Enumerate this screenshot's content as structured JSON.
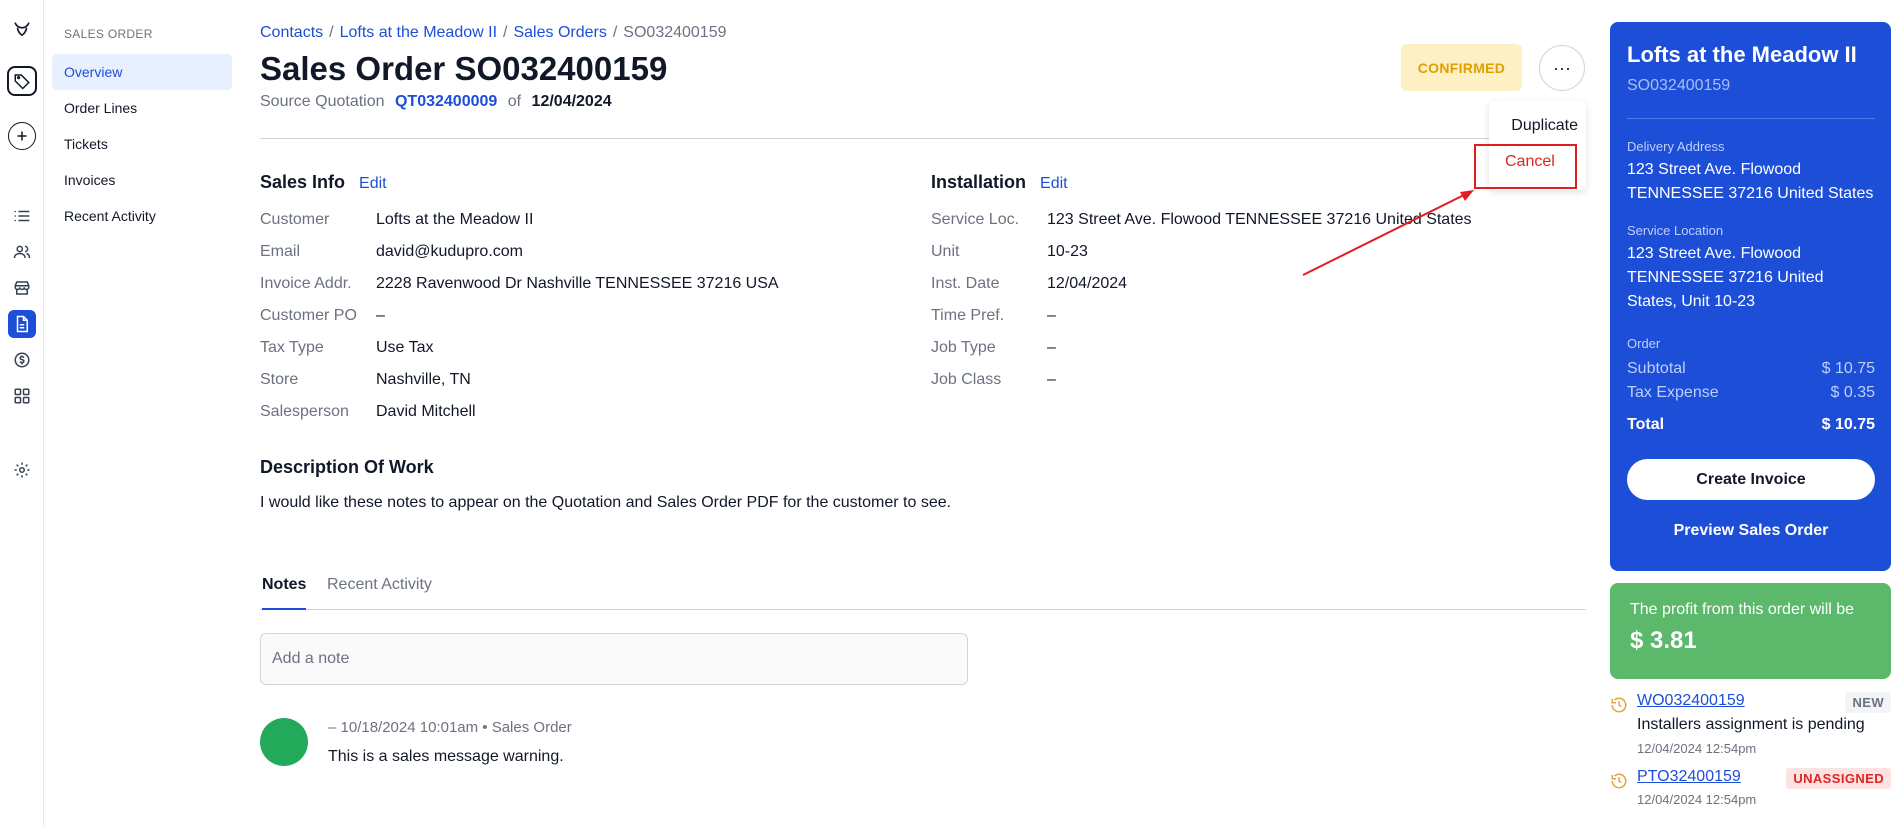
{
  "rail": {
    "icons": [
      "logo-icon",
      "tag-icon",
      "plus-icon",
      "list-icon",
      "users-icon",
      "store-icon",
      "document-icon",
      "money-icon",
      "grid-icon",
      "gear-icon"
    ]
  },
  "subnav": {
    "header": "SALES ORDER",
    "items": [
      {
        "label": "Overview"
      },
      {
        "label": "Order Lines"
      },
      {
        "label": "Tickets"
      },
      {
        "label": "Invoices"
      },
      {
        "label": "Recent Activity"
      }
    ]
  },
  "breadcrumb": {
    "items": [
      "Contacts",
      "Lofts at the Meadow II",
      "Sales Orders"
    ],
    "current": "SO032400159",
    "separator": "/"
  },
  "header": {
    "title": "Sales Order SO032400159",
    "source_label": "Source Quotation",
    "source_quote": "QT032400009",
    "of_label": "of",
    "source_date": "12/04/2024",
    "status": "CONFIRMED",
    "more": "···"
  },
  "menu": {
    "duplicate": "Duplicate",
    "cancel": "Cancel"
  },
  "sales_info": {
    "heading": "Sales Info",
    "edit": "Edit",
    "fields": [
      {
        "label": "Customer",
        "value": "Lofts at the Meadow II"
      },
      {
        "label": "Email",
        "value": "david@kudupro.com"
      },
      {
        "label": "Invoice Addr.",
        "value": "2228 Ravenwood Dr Nashville TENNESSEE 37216 USA"
      },
      {
        "label": "Customer PO",
        "value": "–"
      },
      {
        "label": "Tax Type",
        "value": "Use Tax"
      },
      {
        "label": "Store",
        "value": "Nashville, TN"
      },
      {
        "label": "Salesperson",
        "value": "David Mitchell"
      }
    ]
  },
  "installation": {
    "heading": "Installation",
    "edit": "Edit",
    "fields": [
      {
        "label": "Service Loc.",
        "value": "123 Street Ave. Flowood TENNESSEE 37216 United States"
      },
      {
        "label": "Unit",
        "value": "10-23"
      },
      {
        "label": "Inst. Date",
        "value": "12/04/2024"
      },
      {
        "label": "Time Pref.",
        "value": "–"
      },
      {
        "label": "Job Type",
        "value": "–"
      },
      {
        "label": "Job Class",
        "value": "–"
      }
    ]
  },
  "description": {
    "heading": "Description Of Work",
    "text": "I would like these notes to appear on the Quotation and Sales Order PDF for the customer to see."
  },
  "tabs": [
    {
      "label": "Notes"
    },
    {
      "label": "Recent Activity"
    }
  ],
  "note_input": {
    "placeholder": "Add a note"
  },
  "note": {
    "meta": "–  10/18/2024 10:01am • Sales Order",
    "text": "This is a sales message warning."
  },
  "summary": {
    "title": "Lofts at the Meadow II",
    "subtitle": "SO032400159",
    "delivery_label": "Delivery Address",
    "delivery_text": "123 Street Ave. Flowood TENNESSEE 37216 United States",
    "service_label": "Service Location",
    "service_text": "123 Street Ave. Flowood TENNESSEE 37216 United States, Unit 10-23",
    "order_label": "Order",
    "subtotal_label": "Subtotal",
    "subtotal_value": "$ 10.75",
    "tax_label": "Tax Expense",
    "tax_value": "$ 0.35",
    "total_label": "Total",
    "total_value": "$ 10.75",
    "create_invoice": "Create Invoice",
    "preview": "Preview Sales Order"
  },
  "profit": {
    "text": "The profit from this order will be",
    "value": "$ 3.81"
  },
  "related": [
    {
      "id": "WO032400159",
      "badge": "NEW",
      "desc": "Installers assignment is pending",
      "time": "12/04/2024 12:54pm",
      "badge_color": "#6b7280",
      "badge_bg": "#f3f4f6"
    },
    {
      "id": "PTO32400159",
      "badge": "UNASSIGNED",
      "desc": "",
      "time": "12/04/2024 12:54pm",
      "badge_color": "#dc2626",
      "badge_bg": "#fde2e2"
    }
  ]
}
